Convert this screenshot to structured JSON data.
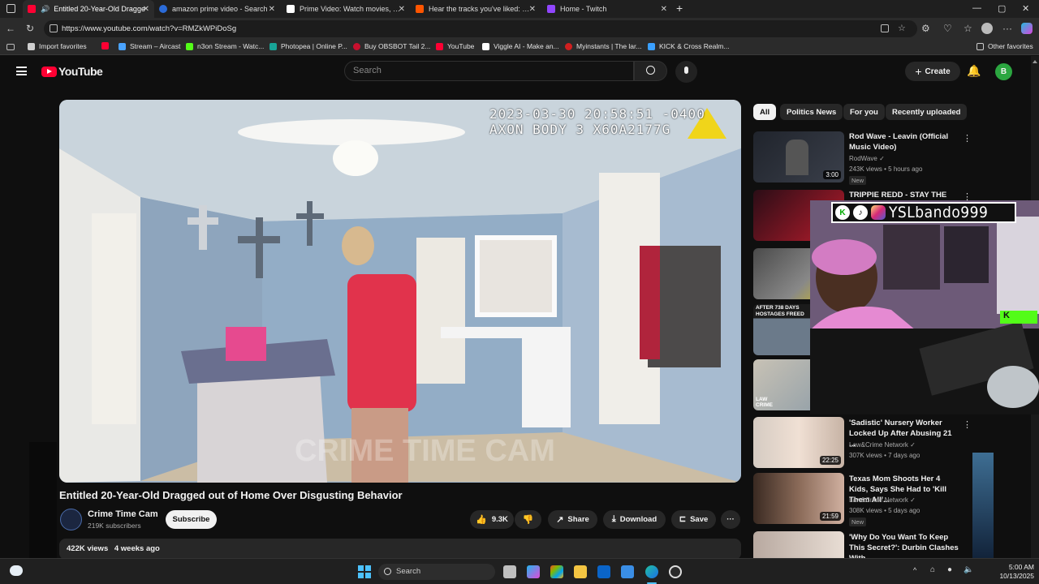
{
  "browser": {
    "tabs": [
      {
        "label": "Entitled 20-Year-Old Dragge",
        "active": true,
        "icon_color": "#ff0033"
      },
      {
        "label": "amazon prime video - Search",
        "active": false,
        "icon_color": "#2b6bd8"
      },
      {
        "label": "Prime Video: Watch movies, TV sh",
        "active": false,
        "icon_color": "#ffffff"
      },
      {
        "label": "Hear the tracks you've liked: on S",
        "active": false,
        "icon_color": "#ff5500"
      },
      {
        "label": "Home - Twitch",
        "active": false,
        "icon_color": "#9146ff"
      }
    ],
    "new_tab": "+",
    "window_controls": [
      "—",
      "▢",
      "✕"
    ],
    "url": "https://www.youtube.com/watch?v=RMZkWPiDoSg",
    "bookmarks": [
      {
        "label": "Import favorites",
        "color": "#cfcfcf"
      },
      {
        "label": "",
        "color": "#ff0033"
      },
      {
        "label": "Stream – Aircast",
        "color": "#4aa3ff"
      },
      {
        "label": "n3on Stream - Watc...",
        "color": "#53fc18"
      },
      {
        "label": "Photopea | Online P...",
        "color": "#18a497"
      },
      {
        "label": "Buy OBSBOT Tail 2...",
        "color": "#c8102e"
      },
      {
        "label": "YouTube",
        "color": "#ff0033"
      },
      {
        "label": "Viggle AI - Make an...",
        "color": "#ffffff"
      },
      {
        "label": "Myinstants | The lar...",
        "color": "#d01f1f"
      },
      {
        "label": "KICK & Cross Realm...",
        "color": "#3aa0ff"
      }
    ],
    "other_favorites": "Other favorites"
  },
  "youtube": {
    "logo_text": "YouTube",
    "search_placeholder": "Search",
    "create_label": "Create",
    "avatar_letter": "B",
    "chips": [
      "All",
      "Politics News",
      "For you",
      "Recently uploaded"
    ],
    "video": {
      "osd_timestamp": "2023-03-30 20:58:51 -0400",
      "osd_device": "AXON BODY 3 X60A2177G",
      "watermark": "CRIME TIME CAM",
      "title": "Entitled 20-Year-Old Dragged out of Home Over Disgusting Behavior",
      "channel": "Crime Time Cam",
      "subscribers": "219K subscribers",
      "subscribe_label": "Subscribe",
      "likes": "9.3K",
      "share_label": "Share",
      "download_label": "Download",
      "save_label": "Save",
      "views": "422K views",
      "age": "4 weeks ago"
    },
    "recommendations": [
      {
        "title": "Rod Wave - Leavin (Official Music Video)",
        "channel": "RodWave",
        "meta": "243K views • 5 hours ago",
        "badge": "New",
        "duration": "3:00"
      },
      {
        "title": "TRIPPIE REDD - STAY THE",
        "channel": "",
        "meta": "",
        "badge": "",
        "duration": ""
      },
      {
        "title": "",
        "channel": "",
        "meta": "",
        "badge": "",
        "duration": ""
      },
      {
        "title": "",
        "channel": "",
        "meta": "",
        "badge": "",
        "duration": "",
        "thumb_text": "AFTER 738 DAYS HOSTAGES FREED"
      },
      {
        "title": "",
        "channel": "",
        "meta": "",
        "badge": "",
        "duration": "",
        "thumb_text": "LAW CRIME"
      },
      {
        "title": "'Sadistic' Nursery Worker Locked Up After Abusing 21 ...",
        "channel": "Law&Crime Network",
        "meta": "307K views • 7 days ago",
        "badge": "",
        "duration": "22:25"
      },
      {
        "title": "Texas Mom Shoots Her 4 Kids, Says She Had to 'Kill Them All'...",
        "channel": "Law&Crime Network",
        "meta": "308K views • 5 days ago",
        "badge": "New",
        "duration": "21:59"
      },
      {
        "title": "'Why Do You Want To Keep This Secret?': Durbin Clashes With ...",
        "channel": "",
        "meta": "",
        "badge": "",
        "duration": ""
      }
    ]
  },
  "overlay": {
    "streamer_tag": "YSLbando999"
  },
  "taskbar": {
    "search_placeholder": "Search",
    "time": "5:00 AM",
    "date": "10/13/2025"
  }
}
